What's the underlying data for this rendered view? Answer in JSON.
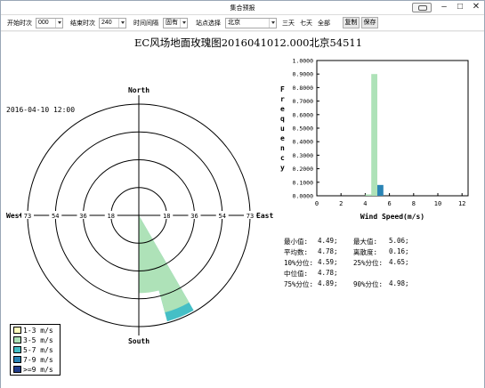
{
  "window": {
    "title": "集合预报"
  },
  "toolbar": {
    "start_label": "开始时次",
    "start_value": "000",
    "end_label": "结束时次",
    "end_value": "240",
    "interval_label": "时间间隔",
    "interval_value": "固有",
    "station_label": "站点选择",
    "station_value": "北京",
    "three_days": "三天",
    "seven_days": "七天",
    "all": "全部",
    "copy_label": "复制",
    "save_label": "保存"
  },
  "rose": {
    "title": "EC风场地面玫瑰图2016041012.000北京54511",
    "datetime": "2016-04-10 12:00",
    "north": "North",
    "south": "South",
    "east": "East",
    "west": "West",
    "ring_labels": [
      "18",
      "36",
      "54",
      "73"
    ]
  },
  "legend": [
    {
      "label": "1-3  m/s",
      "color": "#ffffbe"
    },
    {
      "label": "3-5  m/s",
      "color": "#aee2b8"
    },
    {
      "label": "5-7  m/s",
      "color": "#45bfc6"
    },
    {
      "label": "7-9  m/s",
      "color": "#2a84b5"
    },
    {
      "label": ">=9  m/s",
      "color": "#223e8c"
    }
  ],
  "chart_data": [
    {
      "type": "bar",
      "title": "",
      "ylabel": "Frequency",
      "xlabel": "Wind Speed(m/s)",
      "xlim": [
        0,
        12.5
      ],
      "ylim": [
        0,
        1
      ],
      "xticks": [
        "0",
        "2",
        "4",
        "6",
        "8",
        "10",
        "12"
      ],
      "yticks": [
        "0.0000",
        "0.1000",
        "0.2000",
        "0.3000",
        "0.4000",
        "0.5000",
        "0.6000",
        "0.7000",
        "0.8000",
        "0.9000",
        "1.0000"
      ],
      "bins": [
        {
          "x0": 4.0,
          "x1": 4.5,
          "value": 0.01,
          "color": "#aee2b8"
        },
        {
          "x0": 4.5,
          "x1": 5.0,
          "value": 0.9,
          "color": "#aee2b8"
        },
        {
          "x0": 5.0,
          "x1": 5.5,
          "value": 0.08,
          "color": "#2a84b5"
        }
      ]
    },
    {
      "type": "rose",
      "rlim": [
        0,
        73
      ],
      "sectors": [
        {
          "from_deg": 150,
          "to_deg": 180,
          "speed_bin": "3-5 m/s",
          "value": 51
        },
        {
          "from_deg": 150,
          "to_deg": 165,
          "speed_bin": "3-5 m/s",
          "value": 66
        },
        {
          "from_deg": 150,
          "to_deg": 165,
          "speed_bin": "5-7 m/s",
          "value": 72
        }
      ]
    }
  ],
  "stats": {
    "min_label": "最小值:",
    "min_value": "4.49;",
    "max_label": "最大值:",
    "max_value": "5.06;",
    "mean_label": "平均数:",
    "mean_value": "4.78;",
    "disp_label": "离散度:",
    "disp_value": "0.16;",
    "p10_label": "10%分位:",
    "p10_value": "4.59;",
    "p25_label": "25%分位:",
    "p25_value": "4.65;",
    "median_label": "中位值:",
    "median_value": "4.78;",
    "p75_label": "75%分位:",
    "p75_value": "4.89;",
    "p90_label": "90%分位:",
    "p90_value": "4.98;"
  }
}
